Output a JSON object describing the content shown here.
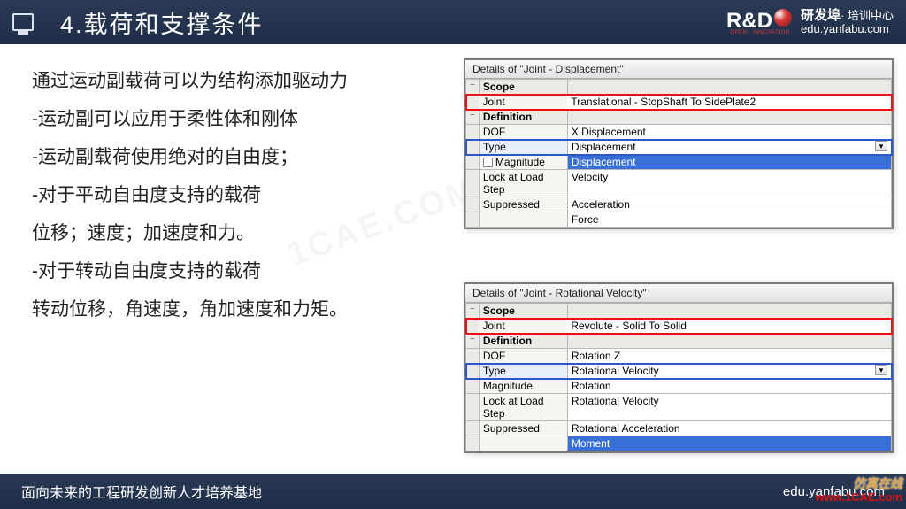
{
  "header": {
    "title": "4.载荷和支撑条件",
    "logo_rd": "R&D",
    "logo_rd_sub": "OPEN · INNOVATION",
    "logo_cn_top": "研发埠",
    "logo_cn_suffix": "· 培训中心",
    "logo_url": "edu.yanfabu.com"
  },
  "body": {
    "p1": "通过运动副载荷可以为结构添加驱动力",
    "p2": "-运动副可以应用于柔性体和刚体",
    "p3": "-运动副载荷使用绝对的自由度；",
    "p4": "-对于平动自由度支持的载荷",
    "p5": "位移；速度；加速度和力。",
    "p6": "-对于转动自由度支持的载荷",
    "p7": "转动位移，角速度，角加速度和力矩。"
  },
  "panel1": {
    "title": "Details of \"Joint - Displacement\"",
    "scope_hdr": "Scope",
    "joint_label": "Joint",
    "joint_value": "Translational - StopShaft To SidePlate2",
    "def_hdr": "Definition",
    "dof_label": "DOF",
    "dof_value": "X Displacement",
    "type_label": "Type",
    "type_value": "Displacement",
    "mag_label": "Magnitude",
    "opt1": "Displacement",
    "opt2": "Velocity",
    "opt3": "Acceleration",
    "opt4": "Force",
    "lock_label": "Lock at Load Step",
    "sup_label": "Suppressed"
  },
  "panel2": {
    "title": "Details of \"Joint - Rotational Velocity\"",
    "scope_hdr": "Scope",
    "joint_label": "Joint",
    "joint_value": "Revolute - Solid To Solid",
    "def_hdr": "Definition",
    "dof_label": "DOF",
    "dof_value": "Rotation Z",
    "type_label": "Type",
    "type_value": "Rotational Velocity",
    "mag_label": "Magnitude",
    "opt1": "Rotation",
    "opt2": "Rotational Velocity",
    "opt3": "Rotational Acceleration",
    "opt4": "Moment",
    "lock_label": "Lock at Load Step",
    "sup_label": "Suppressed"
  },
  "footer": {
    "left": "面向未来的工程研发创新人才培养基地",
    "right": "edu.yanfabu.com"
  },
  "watermarks": {
    "wm1": "1CAE.COM"
  },
  "credit": {
    "l1": "仿真在线",
    "l2": "www.1CAE.com"
  }
}
